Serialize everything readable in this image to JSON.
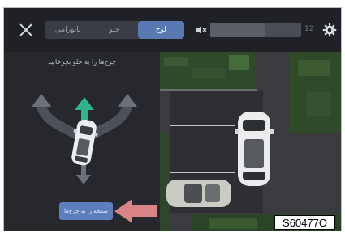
{
  "header": {
    "close_icon": "close-icon",
    "tabs": [
      {
        "label": "بانورامی",
        "active": false
      },
      {
        "label": "جلو",
        "active": false
      },
      {
        "label": "لوح",
        "active": true
      }
    ],
    "volume": {
      "icon": "mute-icon",
      "level_fraction": 0.6,
      "value": "12"
    },
    "settings_icon": "gear-icon"
  },
  "left_panel": {
    "instruction": "چرخ‌ها را به جلو بچرخانید",
    "diagram_icons": [
      "car-top-icon",
      "arrow-up-icon",
      "arrow-left-icon",
      "arrow-right-icon",
      "arrow-down-icon"
    ],
    "action_button": "صفحه را به چرخ‌ها",
    "accent_green": "#2fb58a",
    "button_color": "#5d7fbe"
  },
  "camera_view": {
    "icons": [
      "car-top-icon",
      "parked-car-icon"
    ]
  },
  "watermark": "S60477O"
}
